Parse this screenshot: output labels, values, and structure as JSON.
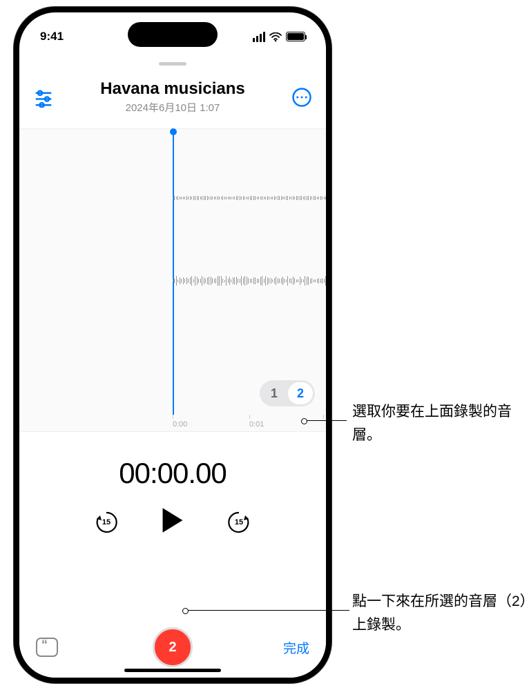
{
  "status_bar": {
    "time": "9:41"
  },
  "header": {
    "title": "Havana musicians",
    "subtitle": "2024年6月10日  1:07"
  },
  "time_ruler": {
    "t0": "0:00",
    "t1": "0:01"
  },
  "layers": {
    "l1": "1",
    "l2": "2"
  },
  "timer": "00:00.00",
  "skip_back_seconds": "15",
  "skip_fwd_seconds": "15",
  "record_layer_badge": "2",
  "done_label": "完成",
  "callouts": {
    "c1": "選取你要在上面錄製的音層。",
    "c2": "點一下來在所選的音層（2）上錄製。"
  }
}
